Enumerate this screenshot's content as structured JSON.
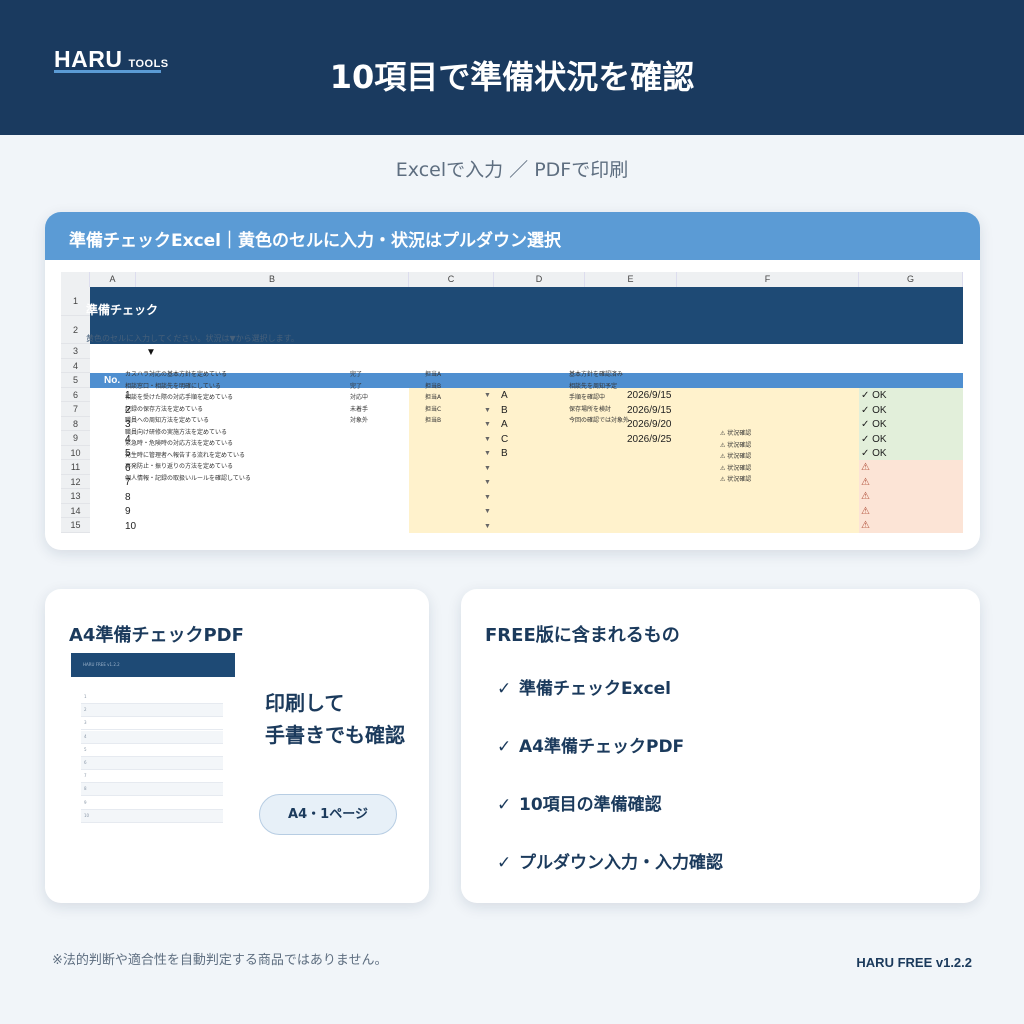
{
  "header": {
    "logo_main": "HARU",
    "logo_sub": "TOOLS",
    "title": "10項目で準備状況を確認"
  },
  "subtitle": "Excelで入力 ／ PDFで印刷",
  "excel_card": {
    "banner": "準備チェックExcel｜黄色のセルに入力・状況はプルダウン選択",
    "sheet": {
      "columns": [
        "A",
        "B",
        "C",
        "D",
        "E",
        "F",
        "G"
      ],
      "row_numbers": [
        "1",
        "2",
        "3",
        "4",
        "5",
        "6",
        "7",
        "8",
        "9",
        "10",
        "11",
        "12",
        "13",
        "14",
        "15"
      ],
      "title": "準備チェック",
      "note": "黄色のセルに入力してください。状況は▼から選択します。",
      "arrow": "▼",
      "no_header": "No.",
      "numbers": [
        "1",
        "2",
        "3",
        "4",
        "5",
        "6",
        "7",
        "8",
        "9",
        "10"
      ],
      "items": [
        "カスハラ対応の基本方針を定めている",
        "相談窓口・相談先を明確にしている",
        "相談を受けた際の対応手順を定めている",
        "記録の保存方法を定めている",
        "職員への周知方法を定めている",
        "職員向け研修の実施方法を定めている",
        "緊急時・危険時の対応方法を定めている",
        "発生時に管理者へ報告する流れを定めている",
        "再発防止・振り返りの方法を定めている",
        "個人情報・記録の取扱いルールを確認している"
      ],
      "status_values": [
        "完了",
        "完了",
        "対応中",
        "未着手",
        "対象外"
      ],
      "owner_values": [
        "担当A",
        "担当B",
        "担当A",
        "担当C",
        "担当B"
      ],
      "priority_values": [
        "A",
        "B",
        "A",
        "C",
        "B"
      ],
      "dates": [
        "2026/9/15",
        "2026/9/15",
        "2026/9/20",
        "2026/9/25"
      ],
      "memo_values": [
        "基本方針を確認済み",
        "相談先を周知予定",
        "手順を確認中",
        "保存場所を検討",
        "今回の確認では対象外"
      ],
      "check_values": [
        "⚠ 状況確認",
        "⚠ 状況確認",
        "⚠ 状況確認",
        "⚠ 状況確認",
        "⚠ 状況確認"
      ],
      "result_ok": [
        "✓ OK",
        "✓ OK",
        "✓ OK",
        "✓ OK",
        "✓ OK"
      ],
      "result_warn": [
        "⚠",
        "⚠",
        "⚠",
        "⚠",
        "⚠"
      ]
    }
  },
  "pdf_card": {
    "title": "A4準備チェックPDF",
    "thumb_title": "HARU FREE v1.2.2",
    "thumb_rows": [
      "1",
      "2",
      "3",
      "4",
      "5",
      "6",
      "7",
      "8",
      "9",
      "10"
    ],
    "message_line1": "印刷して",
    "message_line2": "手書きでも確認",
    "pill": "A4・1ページ"
  },
  "free_card": {
    "title": "FREE版に含まれるもの",
    "check_glyph": "✓",
    "items": [
      "準備チェックExcel",
      "A4準備チェックPDF",
      "10項目の準備確認",
      "プルダウン入力・入力確認"
    ]
  },
  "footer": {
    "note": "※法的判断や適合性を自動判定する商品ではありません。",
    "version": "HARU FREE v1.2.2"
  },
  "colors": {
    "header_bg": "#1a3a5f",
    "accent": "#5b9bd5",
    "input_yellow": "#fff2cc",
    "ok_green": "#e2efda",
    "warn_pink": "#fce4d6"
  }
}
